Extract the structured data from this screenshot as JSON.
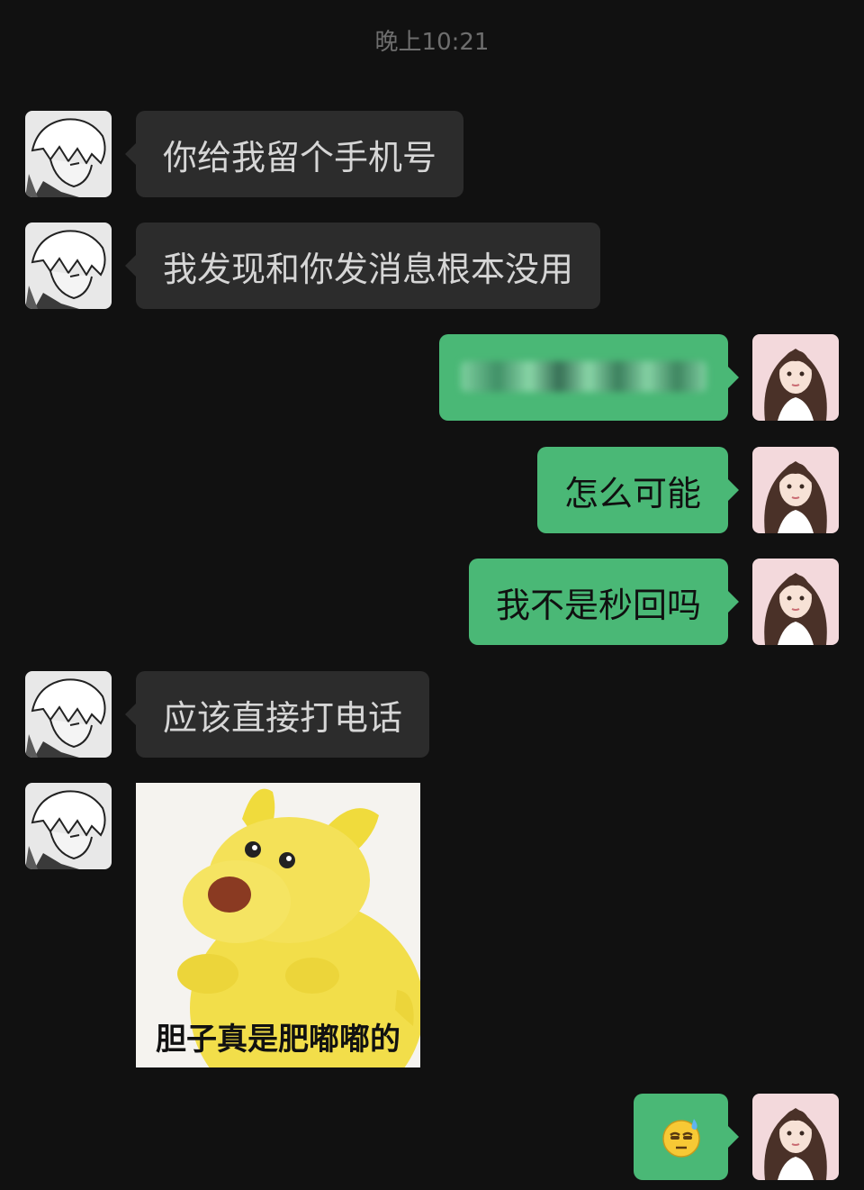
{
  "header": {
    "timestamp": "晚上10:21"
  },
  "messages": [
    {
      "sender": "other",
      "type": "text",
      "text": "你给我留个手机号"
    },
    {
      "sender": "other",
      "type": "text",
      "text": "我发现和你发消息根本没用"
    },
    {
      "sender": "me",
      "type": "text",
      "text": ""
    },
    {
      "sender": "me",
      "type": "text",
      "text": "怎么可能"
    },
    {
      "sender": "me",
      "type": "text",
      "text": "我不是秒回吗"
    },
    {
      "sender": "other",
      "type": "text",
      "text": "应该直接打电话"
    },
    {
      "sender": "other",
      "type": "sticker",
      "caption": "胆子真是肥嘟嘟的"
    },
    {
      "sender": "me",
      "type": "emoji",
      "text": "😓"
    }
  ],
  "colors": {
    "background": "#111111",
    "incoming_bubble": "#2c2c2c",
    "outgoing_bubble": "#4ab876"
  }
}
